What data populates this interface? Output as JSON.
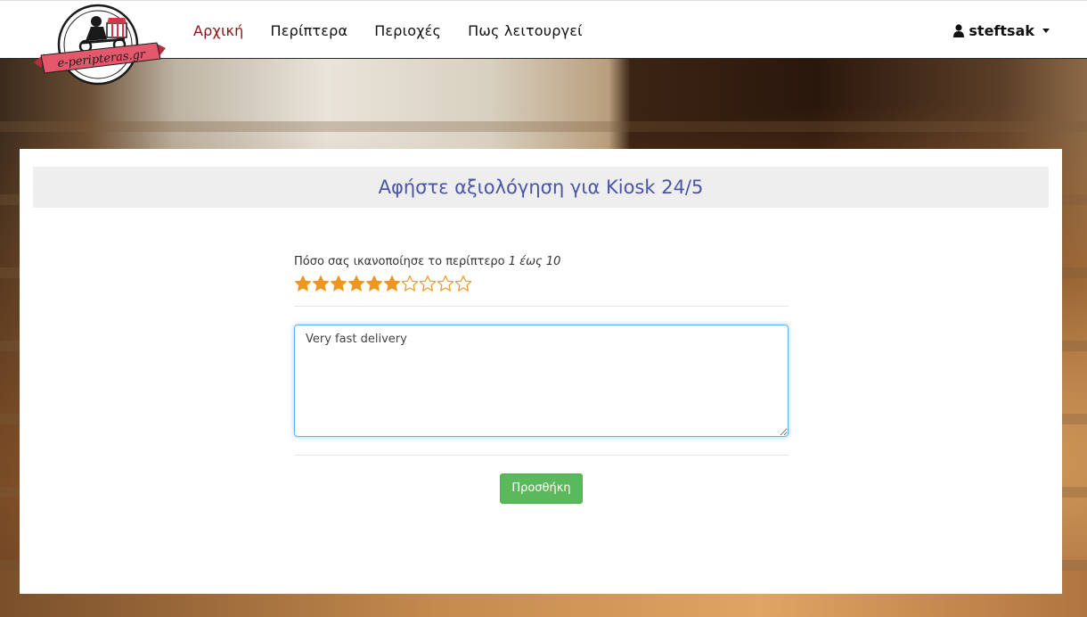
{
  "brand": {
    "logo_text": "e-peripteras.gr"
  },
  "nav": {
    "items": [
      {
        "label": "Αρχική",
        "active": true
      },
      {
        "label": "Περίπτερα",
        "active": false
      },
      {
        "label": "Περιοχές",
        "active": false
      },
      {
        "label": "Πως λειτουργεί",
        "active": false
      }
    ],
    "user": {
      "name": "steftsak",
      "icon": "user-icon"
    }
  },
  "review": {
    "heading": "Αφήστε αξιολόγηση για Kiosk 24/5",
    "rating_label": "Πόσο σας ικανοποίησε το περίπτερο",
    "rating_range": "1 έως 10",
    "rating_value": 6,
    "rating_max": 10,
    "comment": "Very fast delivery",
    "submit_label": "Προσθήκη"
  },
  "colors": {
    "accent": "#8b1414",
    "heading": "#4a55a6",
    "star": "#f0961e",
    "submit": "#5cb85c"
  }
}
